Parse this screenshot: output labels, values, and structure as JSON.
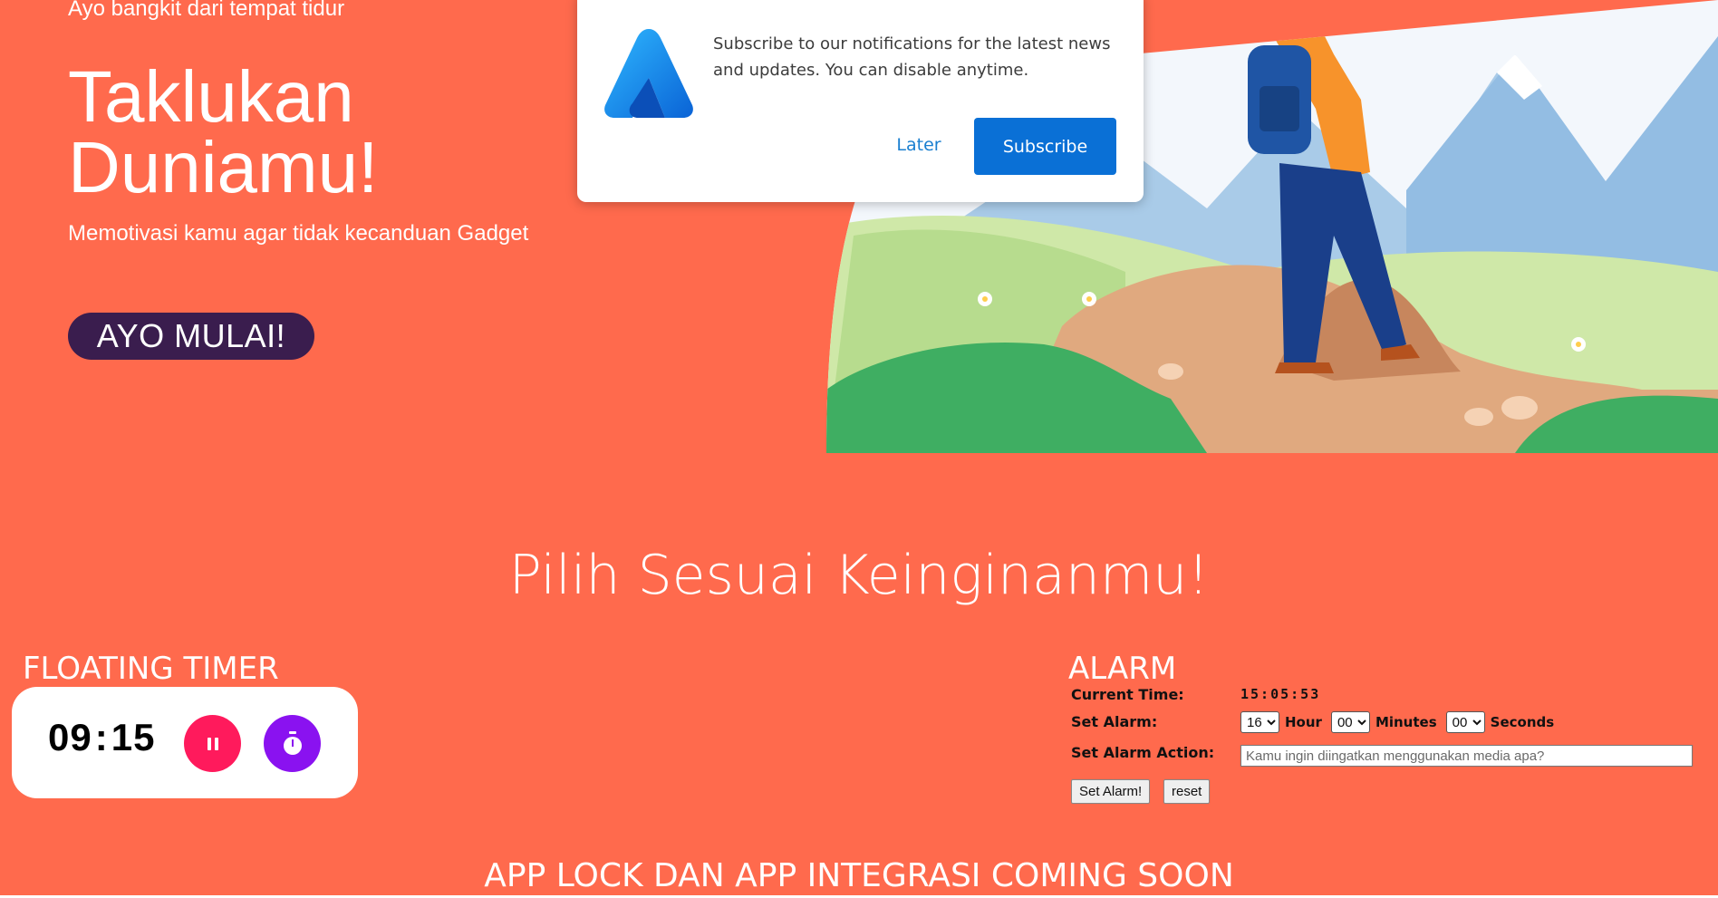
{
  "hero": {
    "eyebrow": "Ayo bangkit dari tempat tidur",
    "title_line1": "Taklukan",
    "title_line2": "Duniamu!",
    "subtitle": "Memotivasi kamu agar tidak kecanduan Gadget",
    "cta_label": "AYO MULAI!"
  },
  "popup": {
    "message_line1": "Subscribe to our notifications for the latest news",
    "message_line2": "and updates. You can disable anytime.",
    "later_label": "Later",
    "subscribe_label": "Subscribe",
    "logo_icon": "bell-brand-logo-icon"
  },
  "section": {
    "title": "Pilih Sesuai Keinginanmu!"
  },
  "floating_timer": {
    "title": "FLOATING TIMER",
    "minutes": "09",
    "separator": ":",
    "seconds": "15",
    "pause_icon": "pause-icon",
    "stopwatch_icon": "stopwatch-icon"
  },
  "alarm": {
    "title": "ALARM",
    "current_time_label": "Current Time:",
    "current_time": "15:05:53",
    "set_alarm_label": "Set Alarm:",
    "hour_value": "16",
    "hour_label": "Hour",
    "minutes_value": "00",
    "minutes_label": "Minutes",
    "seconds_value": "00",
    "seconds_label": "Seconds",
    "action_label": "Set Alarm Action:",
    "action_placeholder": "Kamu ingin diingatkan menggunakan media apa?",
    "set_button": "Set Alarm!",
    "reset_button": "reset"
  },
  "coming_soon": {
    "title": "APP LOCK DAN APP INTEGRASI COMING SOON"
  },
  "colors": {
    "background": "#ff6a4d",
    "cta": "#3a1d4e",
    "subscribe": "#0a70d6",
    "pause": "#ff1a5c",
    "stopwatch": "#8a12f0"
  }
}
